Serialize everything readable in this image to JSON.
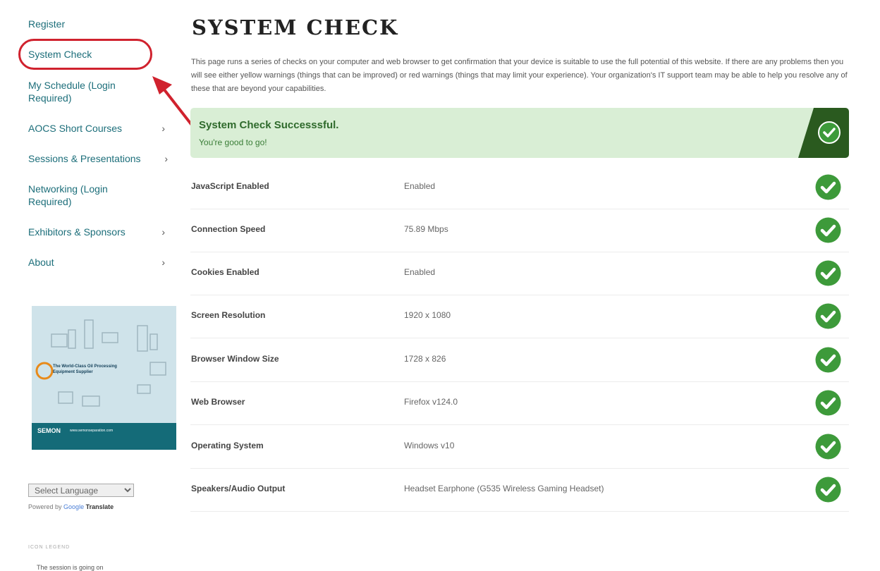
{
  "sidebar": {
    "items": [
      {
        "label": "Register",
        "chevron": false
      },
      {
        "label": "System Check",
        "chevron": false
      },
      {
        "label": "My Schedule (Login Required)",
        "chevron": false
      },
      {
        "label": "AOCS Short Courses",
        "chevron": true
      },
      {
        "label": "Sessions & Presentations",
        "chevron": true
      },
      {
        "label": "Networking (Login Required)",
        "chevron": false
      },
      {
        "label": "Exhibitors & Sponsors",
        "chevron": true
      },
      {
        "label": "About",
        "chevron": true
      }
    ],
    "chevron_glyph": "›",
    "language_select": "Select Language",
    "powered_by": "Powered by",
    "google": "Google",
    "translate": "Translate",
    "icon_legend": "ICON LEGEND",
    "cut_text": "The session is going on"
  },
  "main": {
    "title": "SYSTEM CHECK",
    "intro": "This page runs a series of checks on your computer and web browser to get confirmation that your device is suitable to use the full potential of this website. If there are any problems then you will see either yellow warnings (things that can be improved) or red warnings (things that may limit your experience). Your organization's IT support team may be able to help you resolve any of these that are beyond your capabilities.",
    "success": {
      "title": "System Check Successsful.",
      "subtitle": "You're good to go!"
    },
    "checks": [
      {
        "label": "JavaScript Enabled",
        "value": "Enabled"
      },
      {
        "label": "Connection Speed",
        "value": "75.89 Mbps"
      },
      {
        "label": "Cookies Enabled",
        "value": "Enabled"
      },
      {
        "label": "Screen Resolution",
        "value": "1920 x 1080"
      },
      {
        "label": "Browser Window Size",
        "value": "1728 x 826"
      },
      {
        "label": "Web Browser",
        "value": "Firefox v124.0"
      },
      {
        "label": "Operating System",
        "value": "Windows v10"
      },
      {
        "label": "Speakers/Audio Output",
        "value": "Headset Earphone (G535 Wireless Gaming Headset)"
      }
    ]
  },
  "colors": {
    "link": "#1c6e7a",
    "success_bg": "#d9eed5",
    "success_dark": "#2a5a1f",
    "check_green": "#3d9a3a",
    "annotation_red": "#d0222e"
  },
  "icons": [
    "check-circle-icon",
    "chevron-right-icon",
    "red-arrow-annotation"
  ],
  "banner": {
    "tagline": "The World-Class Oil Processing Equipment Supplier",
    "logo": "SEMON",
    "url": "www.semonseparation.com"
  }
}
